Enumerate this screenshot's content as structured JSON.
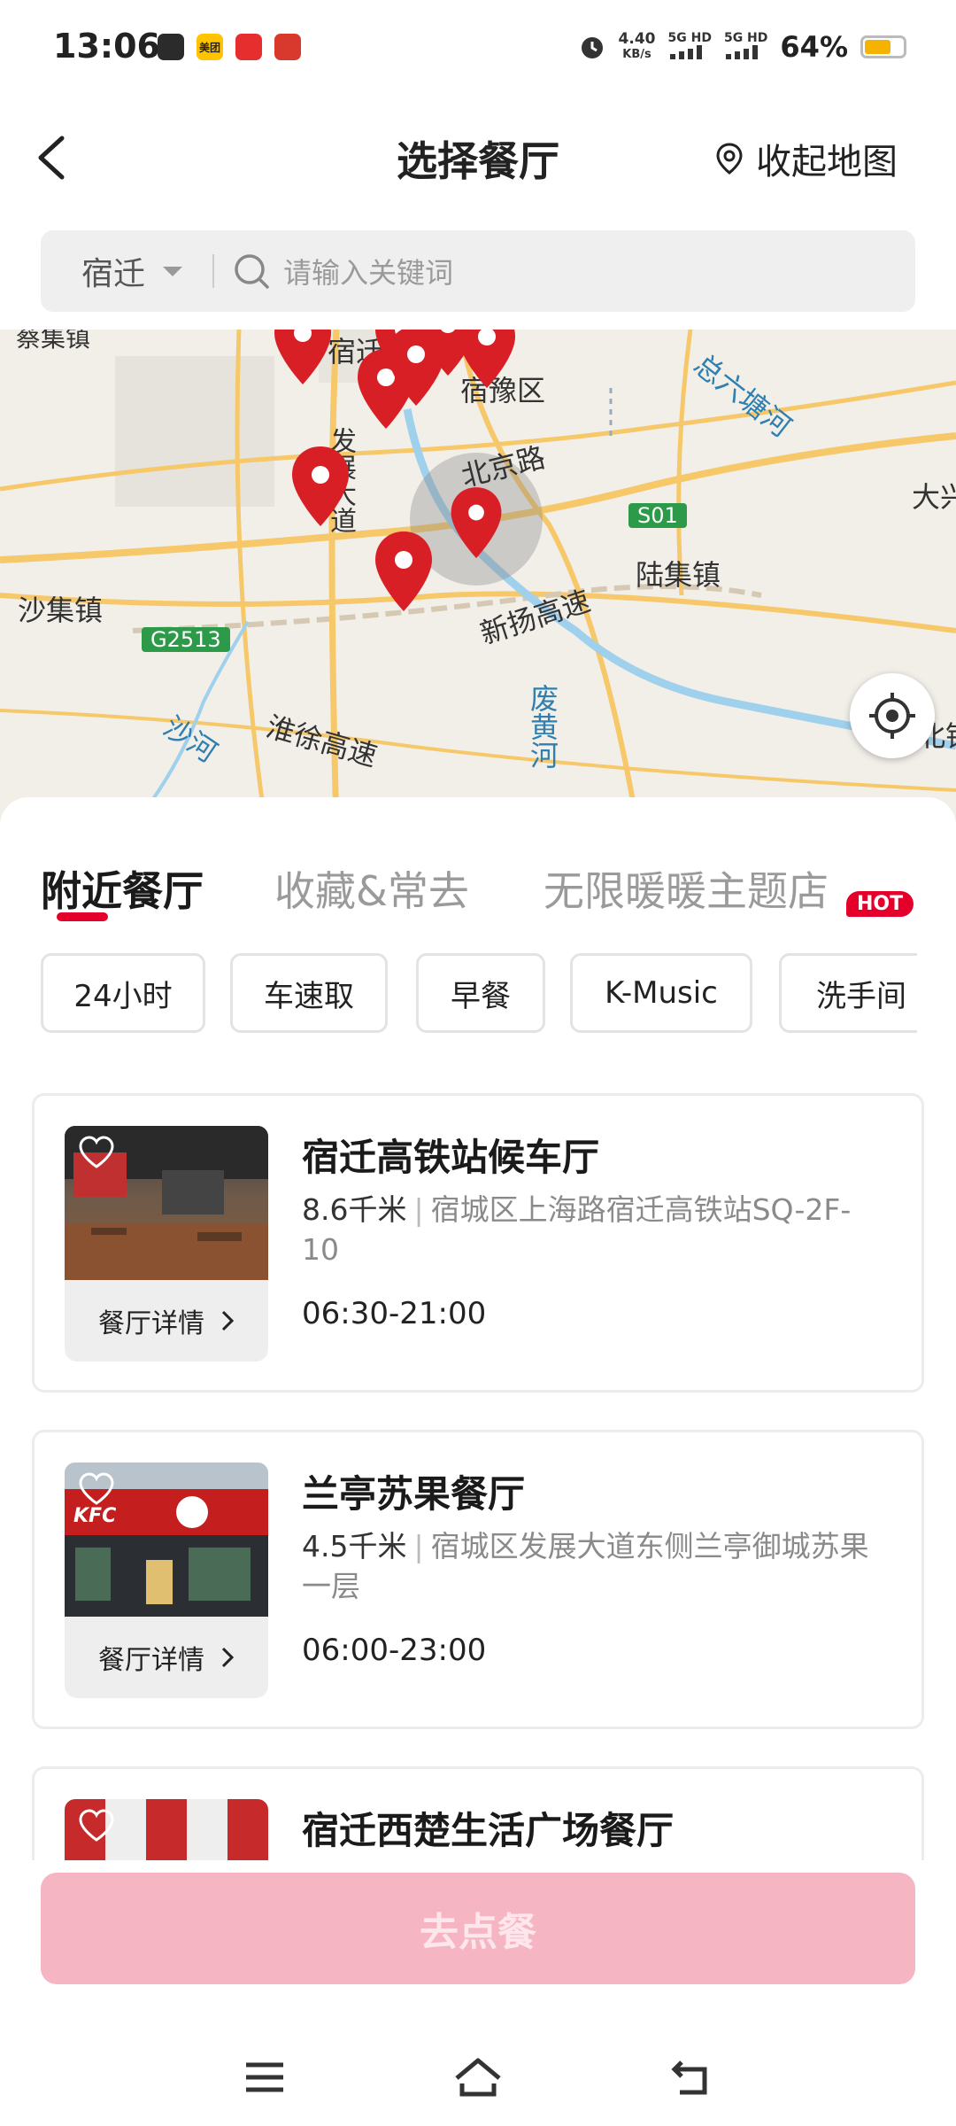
{
  "status_bar": {
    "time": "13:06",
    "net_speed_value": "4.40",
    "net_speed_unit": "KB/s",
    "signal_1": "5G HD",
    "signal_2": "5G HD",
    "battery_percent": "64%",
    "battery_level": 0.64,
    "icons": [
      "app-icon",
      "meituan-icon",
      "app-icon",
      "app-icon",
      "alarm-icon",
      "signal-icon",
      "battery-icon"
    ],
    "meituan_label": "美团"
  },
  "header": {
    "title": "选择餐厅",
    "collapse_map_label": "收起地图"
  },
  "search": {
    "city": "宿迁",
    "placeholder": "请输入关键词"
  },
  "map": {
    "labels": [
      "宿豫区",
      "北京路",
      "大兴",
      "沙集镇",
      "陆集镇",
      "新扬高速",
      "淮徐高速",
      "沙河",
      "废黄河",
      "总六塘河",
      "S01",
      "G2513",
      "宿迁",
      "发展大道",
      "北镇",
      "蔡集镇"
    ],
    "pin_count": 9,
    "pin_color": "#d81f26"
  },
  "tabs": [
    {
      "label": "附近餐厅",
      "active": true
    },
    {
      "label": "收藏&常去",
      "active": false
    },
    {
      "label": "无限暖暖主题店",
      "active": false,
      "badge": "HOT"
    }
  ],
  "chips": [
    "24小时",
    "车速取",
    "早餐",
    "K-Music",
    "洗手间"
  ],
  "restaurants": [
    {
      "name": "宿迁高铁站候车厅",
      "distance": "8.6千米",
      "address": "宿城区上海路宿迁高铁站SQ-2F-10",
      "hours": "06:30-21:00",
      "detail_label": "餐厅详情"
    },
    {
      "name": "兰亭苏果餐厅",
      "distance": "4.5千米",
      "address": "宿城区发展大道东侧兰亭御城苏果一层",
      "hours": "06:00-23:00",
      "detail_label": "餐厅详情",
      "kfc_logo": "KFC"
    },
    {
      "name": "宿迁西楚生活广场餐厅"
    }
  ],
  "order_button": "去点餐",
  "colors": {
    "accent": "#e4002b",
    "order_button_disabled": "#f6b5c3"
  }
}
